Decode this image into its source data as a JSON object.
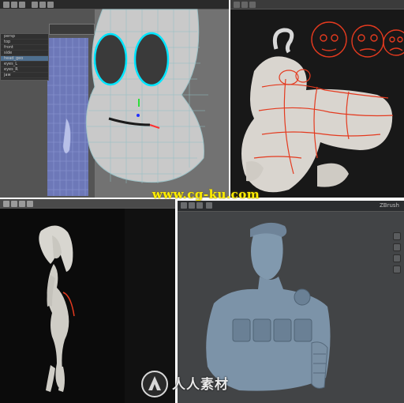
{
  "panels": {
    "top_left": {
      "app": "Maya",
      "outliner_items": [
        "persp",
        "top",
        "front",
        "side",
        "head_geo",
        "eyes_L",
        "eyes_R",
        "jaw",
        "teeth",
        "tongue"
      ]
    },
    "top_right": {
      "app": "ZBrush",
      "subject": "genie-sculpt"
    },
    "bottom_left": {
      "subject": "long-hair-girl-sculpt"
    },
    "bottom_right": {
      "app": "ZBrush",
      "subject": "soldier-bust-sculpt"
    }
  },
  "watermark": {
    "text": "www.cg-ku.com"
  },
  "brand": {
    "text": "人人素材",
    "colors": {
      "watermark": "#ffee00"
    }
  }
}
